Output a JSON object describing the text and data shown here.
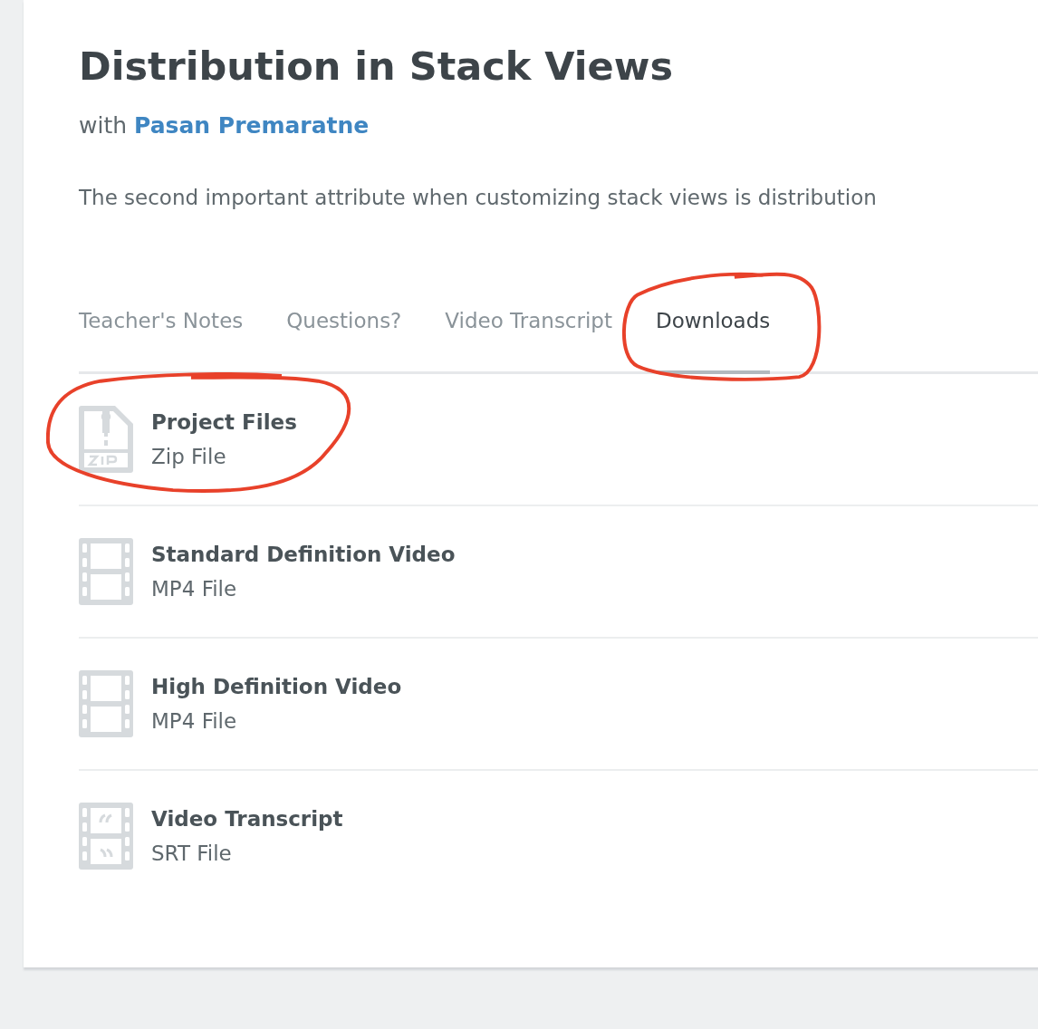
{
  "title": "Distribution in Stack Views",
  "byline": {
    "prefix": "with",
    "author": "Pasan Premaratne"
  },
  "description": "The second important attribute when customizing stack views is distribution",
  "tabs": [
    {
      "label": "Teacher's Notes",
      "selected": false,
      "circled": false
    },
    {
      "label": "Questions?",
      "selected": false,
      "circled": false
    },
    {
      "label": "Video Transcript",
      "selected": false,
      "circled": false
    },
    {
      "label": "Downloads",
      "selected": true,
      "circled": true
    }
  ],
  "downloads": [
    {
      "kind": "zip",
      "title": "Project Files",
      "subtitle": "Zip File",
      "circled": true
    },
    {
      "kind": "video",
      "title": "Standard Definition Video",
      "subtitle": "MP4 File",
      "circled": false
    },
    {
      "kind": "video",
      "title": "High Definition Video",
      "subtitle": "MP4 File",
      "circled": false
    },
    {
      "kind": "transcript",
      "title": "Video Transcript",
      "subtitle": "SRT File",
      "circled": false
    }
  ]
}
